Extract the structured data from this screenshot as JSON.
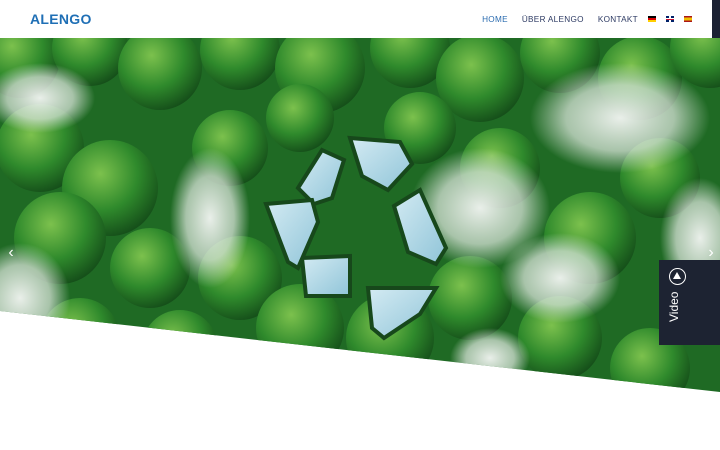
{
  "header": {
    "logo_text": "ALENGO",
    "nav": [
      {
        "label": "HOME",
        "active": true
      },
      {
        "label": "ÜBER ALENGO",
        "active": false
      },
      {
        "label": "KONTAKT",
        "active": false
      }
    ],
    "languages": [
      "de-flag",
      "gb-flag",
      "es-flag"
    ]
  },
  "hero": {
    "image": "aerial forest with recycling-symbol lake",
    "prev_icon": "chevron-left-icon",
    "next_icon": "chevron-right-icon"
  },
  "video_button": {
    "label": "Video",
    "icon": "play-circle-icon"
  },
  "colors": {
    "brand_blue": "#1f6fb5",
    "nav_text": "#2d3a63",
    "dark_panel": "#1d2332"
  }
}
